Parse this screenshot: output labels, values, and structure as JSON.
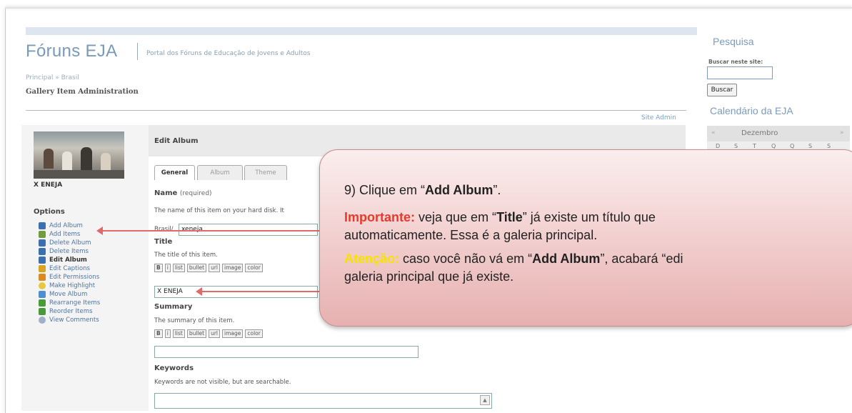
{
  "site": {
    "title": "Fóruns EJA",
    "tagline": "Portal dos Fóruns de Educação de Jovens e Adultos",
    "breadcrumb": [
      "Principal",
      "Brasil"
    ],
    "breadcrumb_sep": "»",
    "page_heading": "Gallery Item Administration",
    "site_admin_link": "Site Admin"
  },
  "sidebar": {
    "item_title": "X ENEJA",
    "options_heading": "Options",
    "options": [
      {
        "label": "Add Album",
        "icon": "add-album-icon",
        "color": "#3a6fb0"
      },
      {
        "label": "Add Items",
        "icon": "add-items-icon",
        "color": "#6f9c3c"
      },
      {
        "label": "Delete Album",
        "icon": "delete-album-icon",
        "color": "#3a6fb0"
      },
      {
        "label": "Delete Items",
        "icon": "delete-items-icon",
        "color": "#3a6fb0"
      },
      {
        "label": "Edit Album",
        "icon": "edit-album-icon",
        "color": "#3a6fb0"
      },
      {
        "label": "Edit Captions",
        "icon": "edit-captions-icon",
        "color": "#d9a520"
      },
      {
        "label": "Edit Permissions",
        "icon": "edit-permissions-icon",
        "color": "#d98a20"
      },
      {
        "label": "Make Highlight",
        "icon": "lightbulb-icon",
        "color": "#e8c840"
      },
      {
        "label": "Move Album",
        "icon": "move-album-icon",
        "color": "#4a8fd0"
      },
      {
        "label": "Rearrange Items",
        "icon": "rearrange-icon",
        "color": "#4a9a3a"
      },
      {
        "label": "Reorder Items",
        "icon": "reorder-icon",
        "color": "#4a9a3a"
      },
      {
        "label": "View Comments",
        "icon": "comments-icon",
        "color": "#a0b0c8"
      }
    ]
  },
  "main": {
    "heading": "Edit Album",
    "tabs": [
      "General",
      "Album",
      "Theme"
    ],
    "name": {
      "label": "Name",
      "required": "(required)",
      "help": "The name of this item on your hard disk. It",
      "path_prefix": "Brasil/",
      "value": "xeneja"
    },
    "title": {
      "label": "Title",
      "help": "The title of this item.",
      "value": "X ENEJA"
    },
    "summary": {
      "label": "Summary",
      "help": "The summary of this item.",
      "value": ""
    },
    "keywords": {
      "label": "Keywords",
      "help": "Keywords are not visible, but are searchable."
    },
    "markup_buttons": [
      "B",
      "i",
      "list",
      "bullet",
      "url",
      "image",
      "color"
    ]
  },
  "right": {
    "search_title": "Pesquisa",
    "search_label": "Buscar neste site:",
    "search_button": "Buscar",
    "calendar_title": "Calendário da EJA",
    "calendar_month": "Dezembro",
    "calendar_prev": "«",
    "calendar_next": "»",
    "weekdays": [
      "D",
      "S",
      "T",
      "Q",
      "Q",
      "S",
      "S"
    ]
  },
  "callout": {
    "step_text": "9) Clique em “",
    "step_bold": "Add Album",
    "step_end": "”.",
    "important_label": "Importante:",
    "important_text_1": " veja que em “",
    "important_bold": "Title",
    "important_text_2": "” já existe um título que",
    "important_line2": "automaticamente. Essa é a galeria principal.",
    "attention_label": "Atenção:",
    "attention_text_1": " caso você não vá em “",
    "attention_bold": "Add Album",
    "attention_text_2": "”, acabará “edi",
    "attention_line2": "galeria principal que já existe."
  }
}
